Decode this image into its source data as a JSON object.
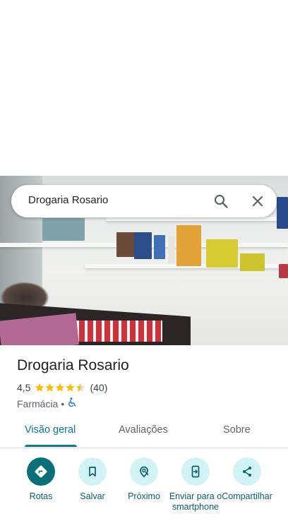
{
  "search": {
    "query": "Drogaria Rosario"
  },
  "place": {
    "name": "Drogaria Rosario",
    "rating": "4,5",
    "stars": 4.5,
    "review_count": "(40)",
    "category": "Farmácia",
    "separator": "•"
  },
  "tabs": [
    {
      "label": "Visão geral",
      "active": true
    },
    {
      "label": "Avaliações",
      "active": false
    },
    {
      "label": "Sobre",
      "active": false
    }
  ],
  "actions": [
    {
      "label": "Rotas",
      "icon": "directions-icon"
    },
    {
      "label": "Salvar",
      "icon": "bookmark-icon"
    },
    {
      "label": "Próximo",
      "icon": "nearby-icon"
    },
    {
      "label": "Enviar para o smartphone",
      "icon": "send-to-phone-icon"
    },
    {
      "label": "Compartilhar",
      "icon": "share-icon"
    }
  ],
  "colors": {
    "accent": "#0b7a8a",
    "star": "#fbbc04",
    "action_bg": "#d2f3f6",
    "primary_action": "#0b6f7a"
  }
}
